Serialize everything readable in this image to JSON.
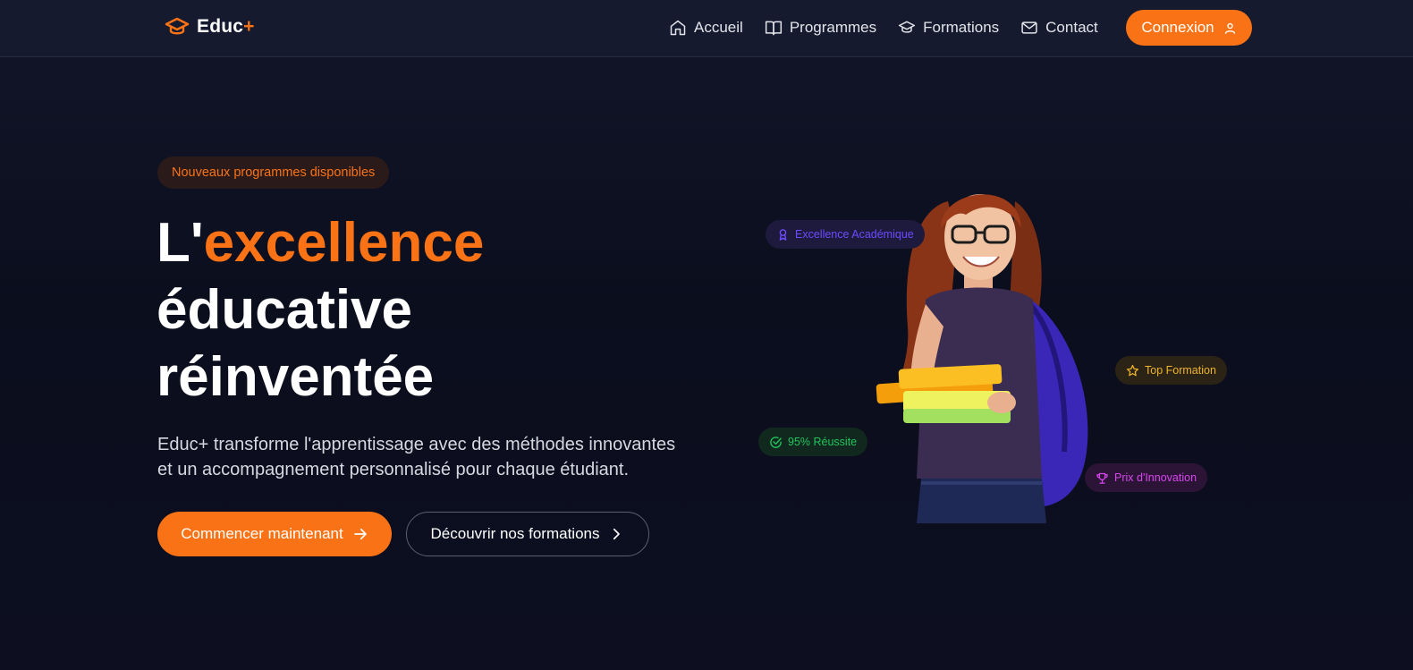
{
  "header": {
    "logo_text": "Educ",
    "logo_plus": "+",
    "nav": [
      {
        "label": "Accueil",
        "icon": "home-icon"
      },
      {
        "label": "Programmes",
        "icon": "book-open-icon"
      },
      {
        "label": "Formations",
        "icon": "graduation-cap-icon"
      },
      {
        "label": "Contact",
        "icon": "mail-icon"
      }
    ],
    "login_label": "Connexion"
  },
  "hero": {
    "badge": "Nouveaux programmes disponibles",
    "title_prefix": "L'",
    "title_accent": "excellence",
    "title_line2": "éducative",
    "title_line3": "réinventée",
    "description": "Educ+ transforme l'apprentissage avec des méthodes innovantes et un accompagnement personnalisé pour chaque étudiant.",
    "primary_cta": "Commencer maintenant",
    "secondary_cta": "Découvrir nos formations"
  },
  "chips": {
    "excellence": "Excellence Académique",
    "top": "Top Formation",
    "success": "95% Réussite",
    "prix": "Prix d'Innovation"
  },
  "colors": {
    "accent": "#f97316",
    "background": "#0b0e1d",
    "header_bg": "#151a2e",
    "chip_purple": "#6d4bff",
    "chip_yellow": "#f0b429",
    "chip_green": "#22c55e",
    "chip_pink": "#d946ef"
  }
}
